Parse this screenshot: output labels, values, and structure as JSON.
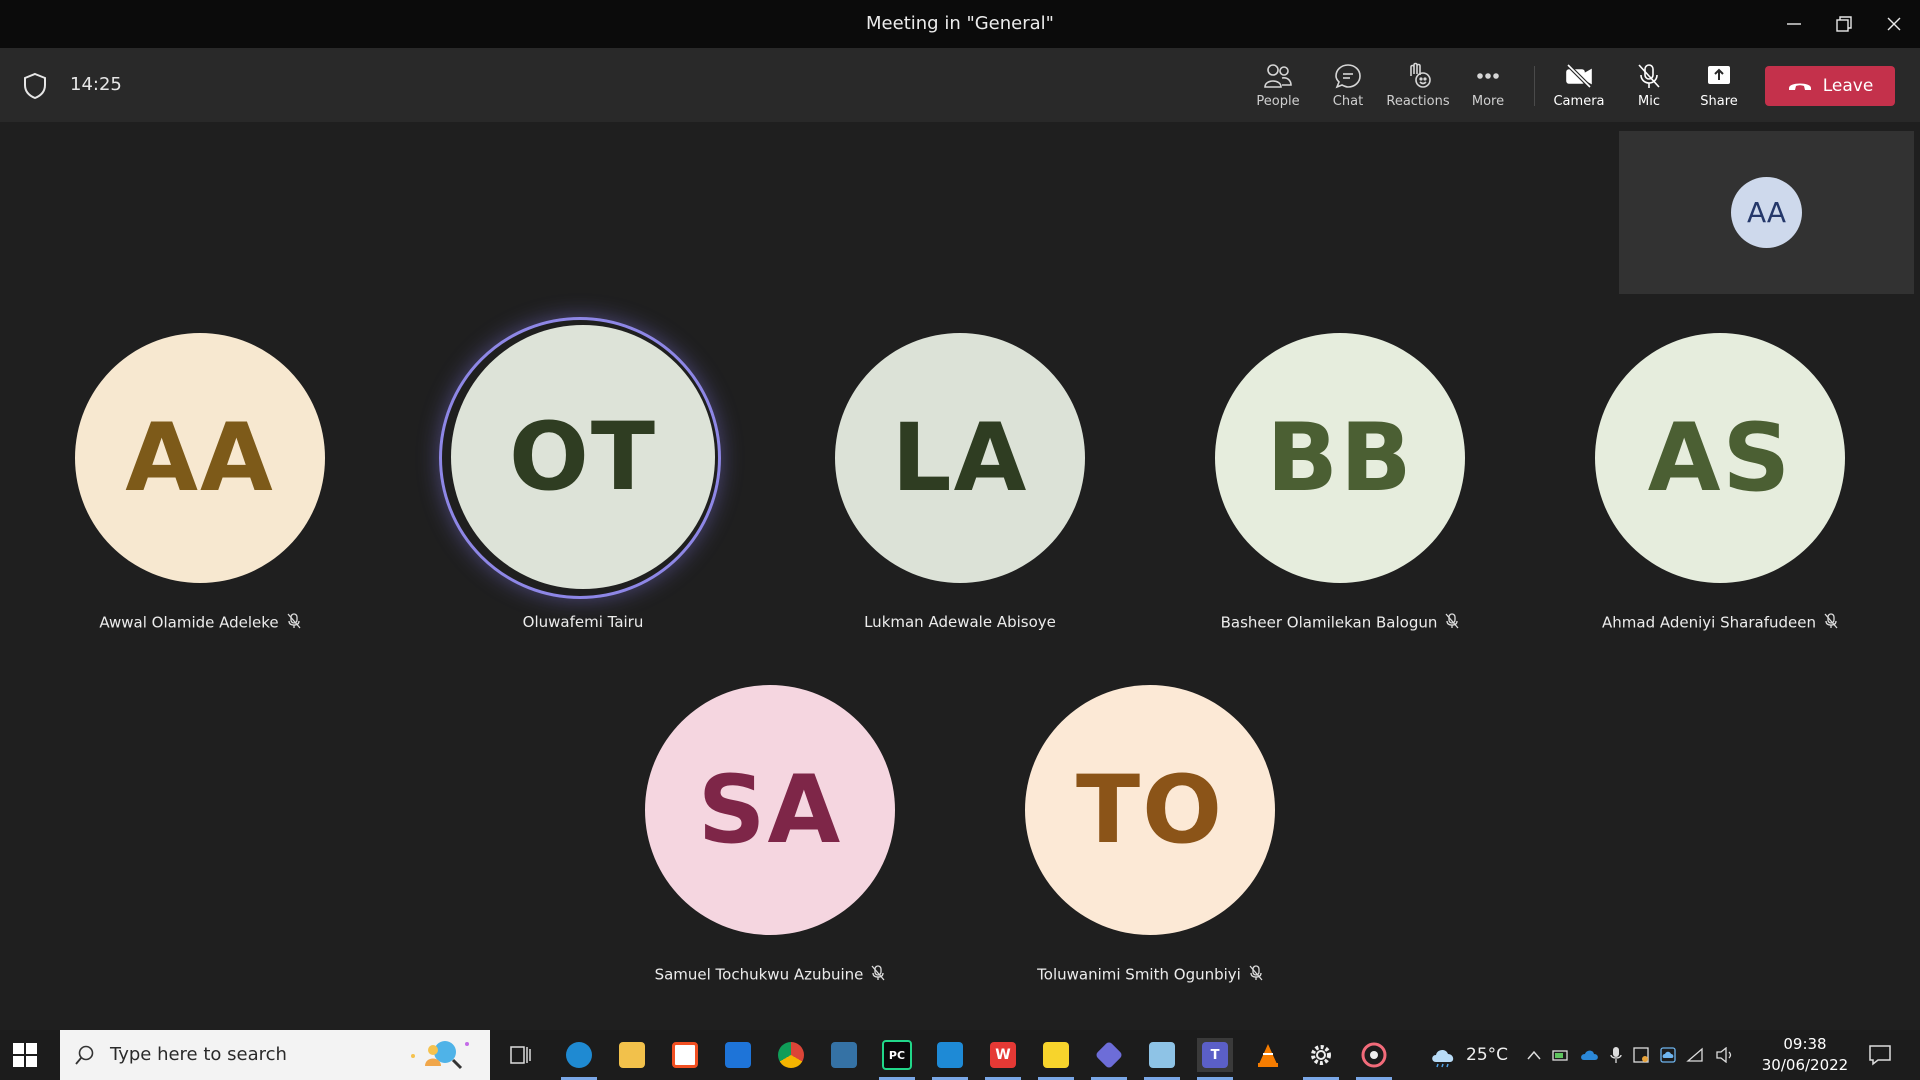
{
  "window": {
    "title": "Meeting in \"General\""
  },
  "toolbar": {
    "timer": "14:25",
    "buttons": [
      {
        "label": "People",
        "icon": "people-icon"
      },
      {
        "label": "Chat",
        "icon": "chat-icon"
      },
      {
        "label": "Reactions",
        "icon": "reactions-icon"
      },
      {
        "label": "More",
        "icon": "more-icon"
      },
      {
        "label": "Camera",
        "icon": "camera-off-icon"
      },
      {
        "label": "Mic",
        "icon": "mic-off-icon"
      },
      {
        "label": "Share",
        "icon": "share-icon"
      }
    ],
    "leave_label": "Leave",
    "leave_color": "#c4314b"
  },
  "self_view": {
    "initials": "AA"
  },
  "participants": [
    {
      "initials": "AA",
      "name": "Awwal Olamide Adeleke",
      "muted": true,
      "bg": "#f7e8d0",
      "fg": "#7d5a19"
    },
    {
      "initials": "OT",
      "name": "Oluwafemi Tairu",
      "muted": false,
      "speaking": true,
      "bg": "#dde3d8",
      "fg": "#2f3d22"
    },
    {
      "initials": "LA",
      "name": "Lukman Adewale Abisoye",
      "muted": false,
      "bg": "#dce2d7",
      "fg": "#2f3d22"
    },
    {
      "initials": "BB",
      "name": "Basheer Olamilekan Balogun",
      "muted": true,
      "bg": "#e6eddd",
      "fg": "#4b5f33"
    },
    {
      "initials": "AS",
      "name": "Ahmad Adeniyi Sharafudeen",
      "muted": true,
      "bg": "#e6eddd",
      "fg": "#4b5f33"
    },
    {
      "initials": "SA",
      "name": "Samuel Tochukwu Azubuine",
      "muted": true,
      "bg": "#f5d6e0",
      "fg": "#7e2648"
    },
    {
      "initials": "TO",
      "name": "Toluwanimi Smith Ogunbiyi",
      "muted": true,
      "bg": "#fce9d6",
      "fg": "#8b5418"
    }
  ],
  "taskbar": {
    "search_placeholder": "Type here to search",
    "weather": "25°C",
    "time": "09:38",
    "date": "30/06/2022",
    "apps": [
      "task-view",
      "edge",
      "file-explorer",
      "microsoft-store",
      "mail",
      "chrome",
      "python",
      "pycharm",
      "vscode",
      "wps-office",
      "sticky-notes",
      "git",
      "notepad",
      "teams",
      "vlc",
      "settings",
      "media-player"
    ]
  }
}
